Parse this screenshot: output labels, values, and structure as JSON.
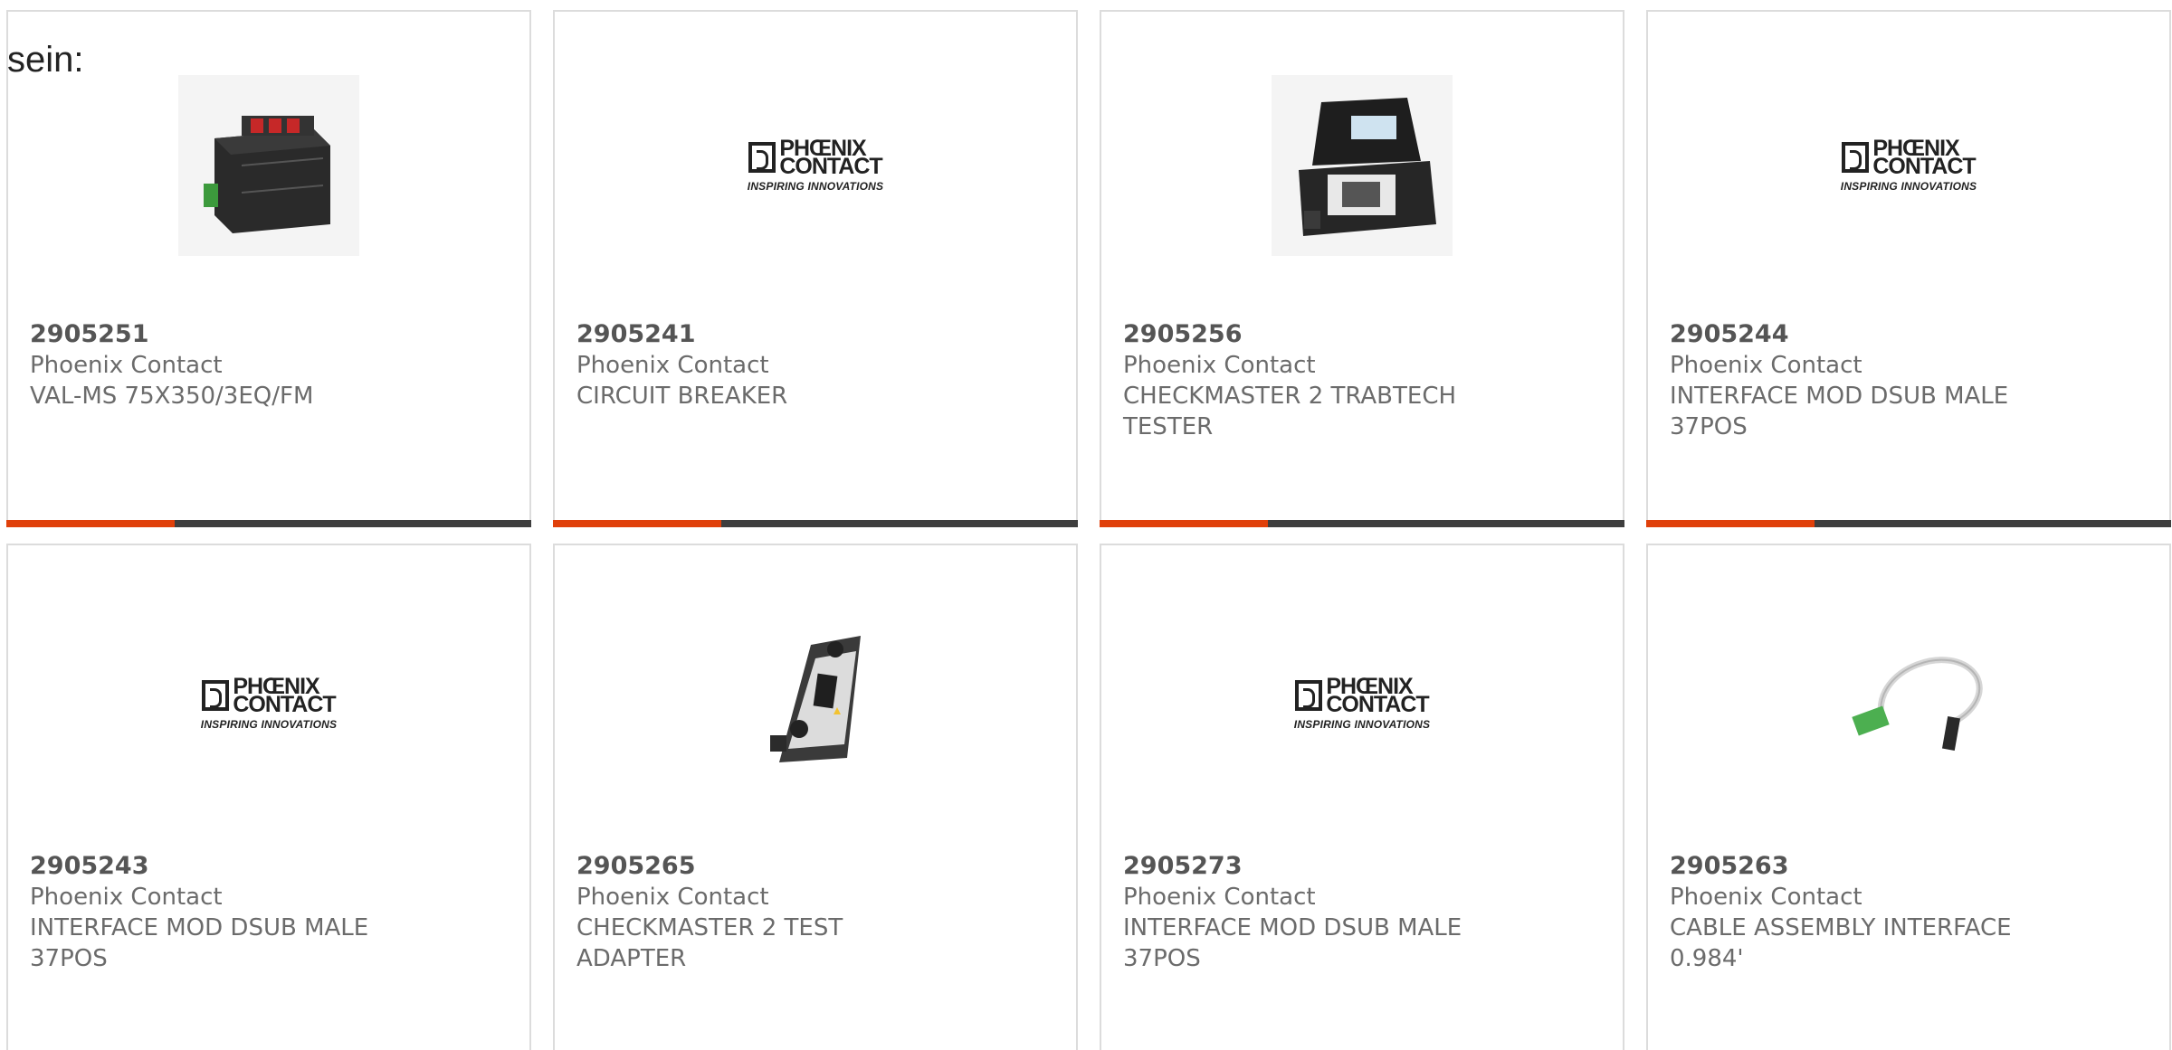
{
  "lead_text": "sein:",
  "colors": {
    "accent": "#e0400a",
    "bar": "#3e3e3e",
    "border": "#dcdcdc",
    "text": "#6b6b6b"
  },
  "logo": {
    "line1": "PHŒNIX",
    "line2": "CONTACT",
    "tagline": "INSPIRING INNOVATIONS"
  },
  "products": [
    {
      "part": "2905251",
      "brand": "Phoenix Contact",
      "description": "VAL-MS 75X350/3EQ/FM",
      "image": "surge-protector-image",
      "progress": 0.32
    },
    {
      "part": "2905241",
      "brand": "Phoenix Contact",
      "description": "CIRCUIT BREAKER",
      "image": "phoenix-logo",
      "progress": 0.32
    },
    {
      "part": "2905256",
      "brand": "Phoenix Contact",
      "description": "CHECKMASTER 2 TRABTECH TESTER",
      "image": "tester-case-image",
      "progress": 0.32
    },
    {
      "part": "2905244",
      "brand": "Phoenix Contact",
      "description": "INTERFACE MOD DSUB MALE 37POS",
      "image": "phoenix-logo",
      "progress": 0.32
    },
    {
      "part": "2905243",
      "brand": "Phoenix Contact",
      "description": "INTERFACE MOD DSUB MALE 37POS",
      "image": "phoenix-logo"
    },
    {
      "part": "2905265",
      "brand": "Phoenix Contact",
      "description": "CHECKMASTER 2 TEST ADAPTER",
      "image": "test-adapter-image"
    },
    {
      "part": "2905273",
      "brand": "Phoenix Contact",
      "description": "INTERFACE MOD DSUB MALE 37POS",
      "image": "phoenix-logo"
    },
    {
      "part": "2905263",
      "brand": "Phoenix Contact",
      "description": "CABLE ASSEMBLY INTERFACE 0.984'",
      "image": "cable-assembly-image"
    }
  ]
}
